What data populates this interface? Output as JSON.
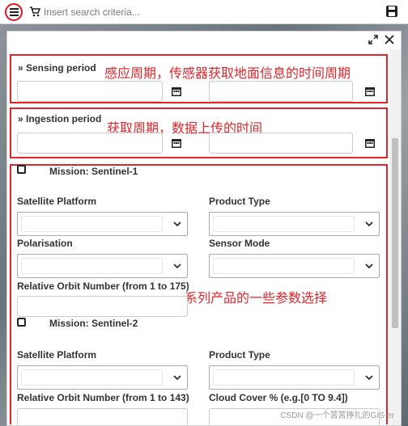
{
  "marker": "1",
  "search": {
    "placeholder": "Insert search criteria..."
  },
  "icons": {
    "menu": "menu-icon",
    "cart": "cart-icon",
    "save": "save-icon",
    "expand": "expand-icon",
    "close": "close-icon",
    "calendar": "calendar-icon",
    "chevron": "chevron-down-icon"
  },
  "colors": {
    "highlight": "#e0262b",
    "panel": "#ffffff",
    "text": "#333333"
  },
  "sensing": {
    "title": "» Sensing period",
    "annotation": "感应周期，传感器获取地面信息的时间周期"
  },
  "ingestion": {
    "title": "» Ingestion period",
    "annotation": "获取周期，数据上传的时间"
  },
  "missions_annotation": "系列产品的一些参数选择",
  "sentinel1": {
    "title": "Mission: Sentinel-1",
    "satellite_platform": "Satellite Platform",
    "product_type": "Product Type",
    "polarisation": "Polarisation",
    "sensor_mode": "Sensor Mode",
    "relative_orbit": "Relative Orbit Number (from 1 to 175)"
  },
  "sentinel2": {
    "title": "Mission: Sentinel-2",
    "satellite_platform": "Satellite Platform",
    "product_type": "Product Type",
    "relative_orbit": "Relative Orbit Number (from 1 to 143)",
    "cloud_cover": "Cloud Cover % (e.g.[0 TO 9.4])"
  },
  "watermark": "CSDN @一个苦苦挣扎的GIS-er"
}
